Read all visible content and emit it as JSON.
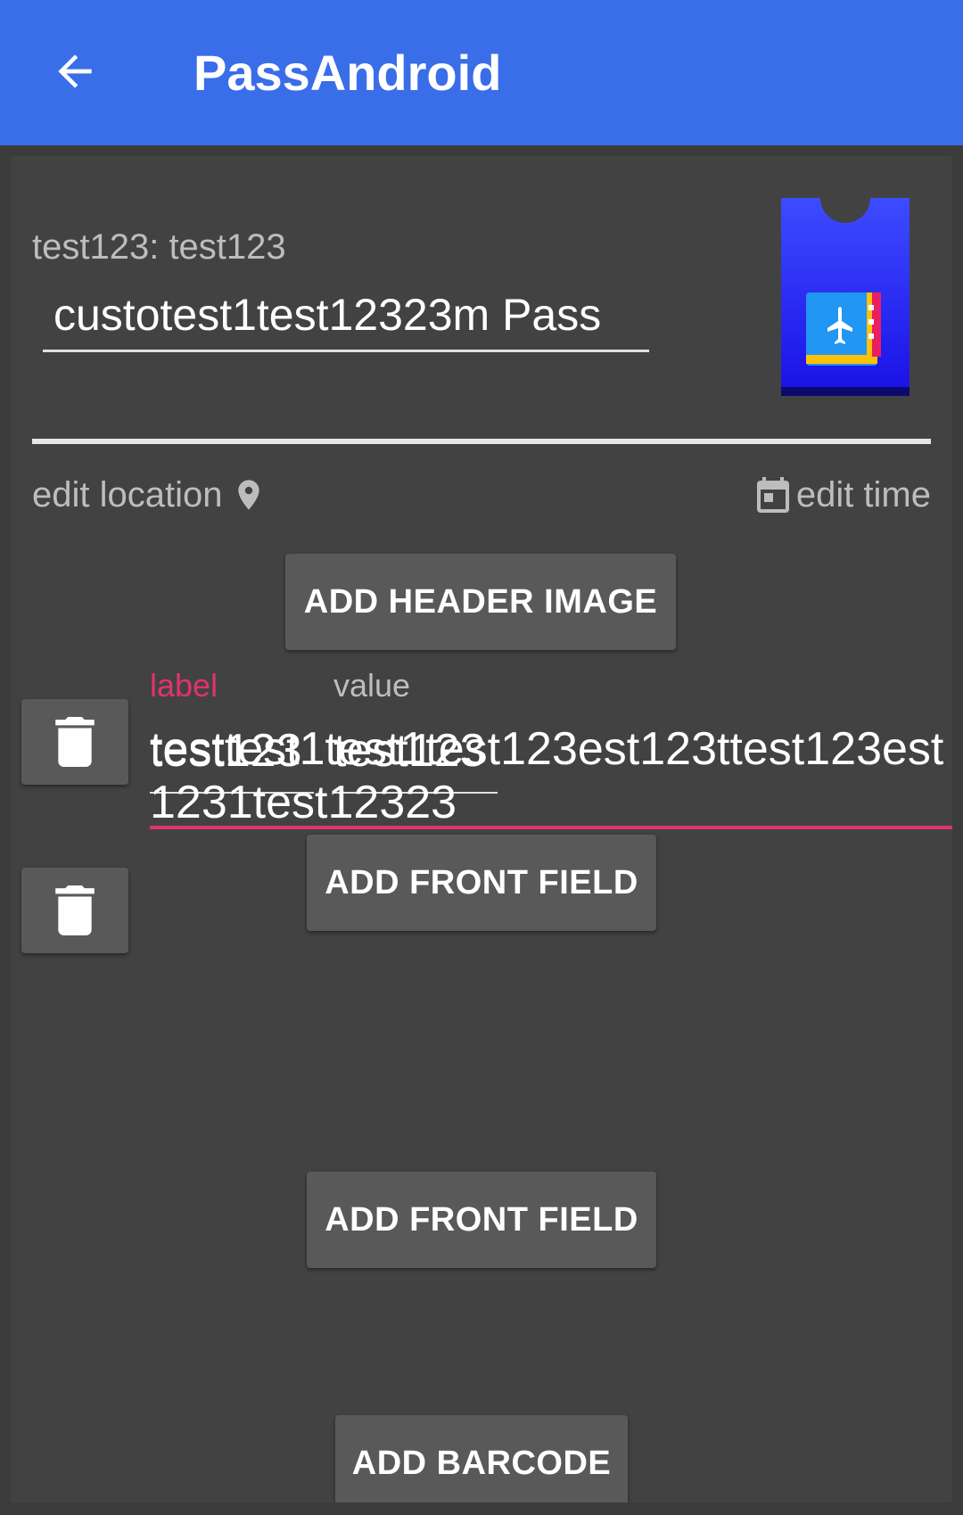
{
  "appbar": {
    "title": "PassAndroid",
    "back_icon": "arrow-back-icon",
    "color": "#3a6ee8"
  },
  "pass": {
    "type_line": "test123: test123",
    "description": "custotest1test12323m Pass",
    "icon": "pass-ticket-icon"
  },
  "actions": {
    "edit_location": "edit location",
    "location_icon": "map-pin-icon",
    "edit_time": "edit time",
    "calendar_icon": "calendar-icon"
  },
  "buttons": {
    "add_header_image": "ADD HEADER IMAGE",
    "add_front_field_1": "ADD FRONT FIELD",
    "add_front_field_2": "ADD FRONT FIELD",
    "add_barcode": "ADD BARCODE"
  },
  "field": {
    "label_hint": "label",
    "value_hint": "value",
    "label_value": "test123",
    "value_value": "test123",
    "overflow_text": "testtest1test1test123est123ttest123est1231test12323",
    "accent": "#e0336b"
  }
}
